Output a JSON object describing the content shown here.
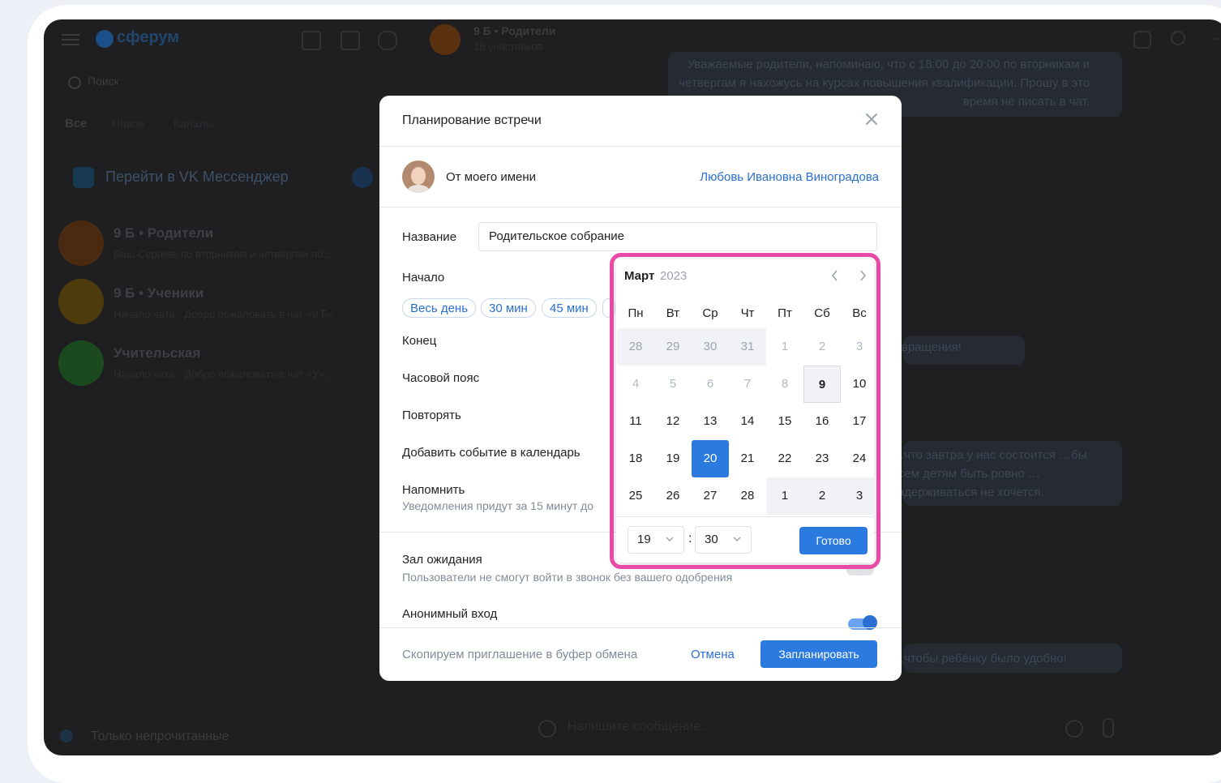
{
  "app": {
    "logo": "сферум",
    "search_placeholder": "Поиск",
    "filters": [
      "Все",
      "Новое",
      "Каналы"
    ],
    "vk_link": "Перейти в VK Мессенджер",
    "chats": [
      {
        "name": "9 Б • Родители",
        "preview": "Ваш Сергеев по вторникам и четвергам по...",
        "color": "#6a3d12"
      },
      {
        "name": "9 Б • Ученики",
        "preview": "Начало чата · Добро пожаловать в чат «9 Б»",
        "color": "#6b5211"
      },
      {
        "name": "Учительская",
        "preview": "Начало чата · Добро пожаловать в чат «Уч...",
        "color": "#1f5b23"
      }
    ],
    "chat_header": {
      "title": "9 Б • Родители",
      "subtitle": "18 участников"
    },
    "messages": [
      "Уважаемые родители, напоминаю, что с 18:00 до 20:00 по вторникам и четвергам я нахожусь на курсах повышения квалификации. Прошу в это время не писать в чат.",
      "…возвращения!",
      "…что завтра у нас состоится …бы всем детям быть ровно …задерживаться не хочется.",
      "…чтобы ребёнку было удобно!"
    ],
    "unread_only": "Только непрочитанные",
    "message_placeholder": "Напишите сообщение..."
  },
  "modal": {
    "title": "Планирование встречи",
    "from_label": "От моего имени",
    "from_user": "Любовь Ивановна Виноградова",
    "name_label": "Название",
    "name_value": "Родительское собрание",
    "start_label": "Начало",
    "quick_durations": [
      "Весь день",
      "30 мин",
      "45 мин"
    ],
    "end_label": "Конец",
    "timezone_label": "Часовой пояс",
    "repeat_label": "Повторять",
    "add_to_calendar_label": "Добавить событие в календарь",
    "remind_label": "Напомнить",
    "remind_sub": "Уведомления придут за 15 минут до",
    "waiting_room_label": "Зал ожидания",
    "waiting_room_sub": "Пользователи не смогут войти в звонок без вашего одобрения",
    "anonymous_label": "Анонимный вход",
    "copy_invite_hint": "Скопируем приглашение в буфер обмена",
    "cancel": "Отмена",
    "schedule": "Запланировать"
  },
  "calendar": {
    "month": "Март",
    "year": "2023",
    "weekdays": [
      "Пн",
      "Вт",
      "Ср",
      "Чт",
      "Пт",
      "Сб",
      "Вс"
    ],
    "weeks": [
      [
        "28",
        "29",
        "30",
        "31",
        "1",
        "2",
        "3"
      ],
      [
        "4",
        "5",
        "6",
        "7",
        "8",
        "9",
        "10"
      ],
      [
        "11",
        "12",
        "13",
        "14",
        "15",
        "16",
        "17"
      ],
      [
        "18",
        "19",
        "20",
        "21",
        "22",
        "23",
        "24"
      ],
      [
        "25",
        "26",
        "27",
        "28",
        "1",
        "2",
        "3"
      ]
    ],
    "selected_day": "20",
    "today": "9",
    "hour": "19",
    "minute": "30",
    "separator": ":",
    "done": "Готово",
    "highlight_color": "#e94aa5"
  }
}
